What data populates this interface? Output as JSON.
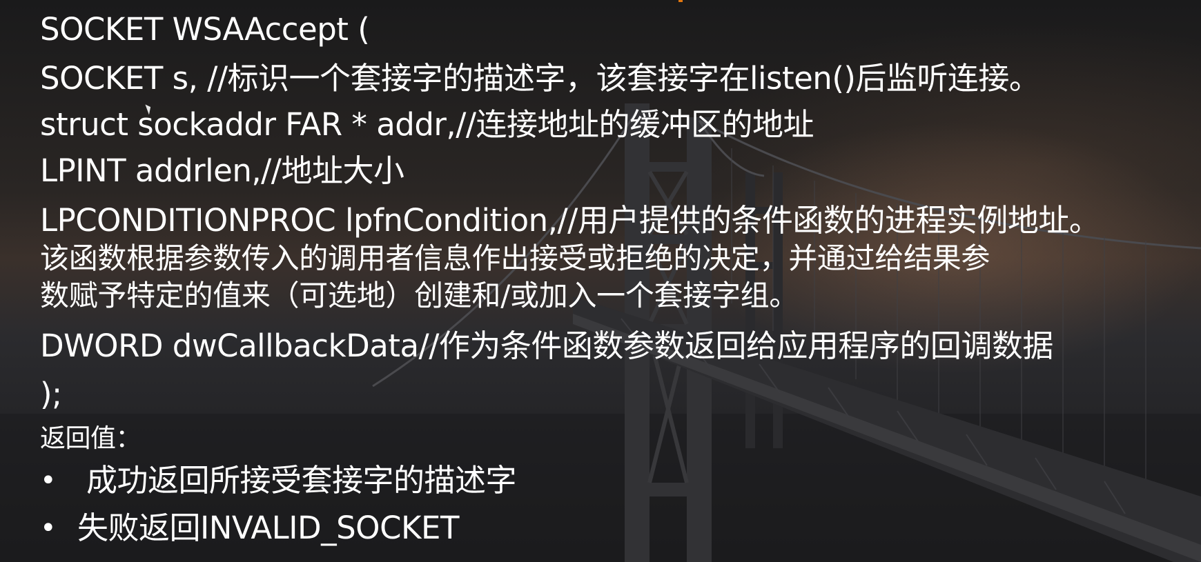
{
  "slide": {
    "accent_color": "#e2770f",
    "text_color": "#ffffff",
    "code_lines": [
      "SOCKET  WSAAccept (",
      "SOCKET s, //标识一个套接字的描述字，该套接字在listen()后监听连接。",
      "struct sockaddr FAR * addr,//连接地址的缓冲区的地址",
      "LPINT addrlen,//地址大小",
      "LPCONDITIONPROC lpfnCondition,//用户提供的条件函数的进程实例地址。",
      "该函数根据参数传入的调用者信息作出接受或拒绝的决定，并通过给结果参",
      "数赋予特定的值来（可选地）创建和/或加入一个套接字组。",
      "DWORD dwCallbackData//作为条件函数参数返回给应用程序的回调数据",
      ");"
    ],
    "return_label": "返回值：",
    "bullets": [
      {
        "marker": "•",
        "text": "成功返回所接受套接字的描述字"
      },
      {
        "marker": "•",
        "text": "失败返回INVALID_SOCKET"
      }
    ]
  }
}
